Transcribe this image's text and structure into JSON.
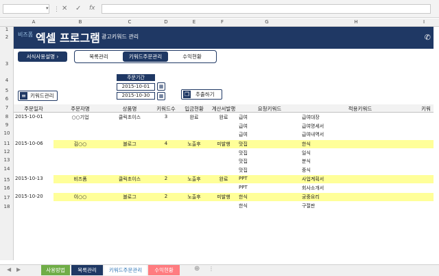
{
  "formula_bar": {
    "fx_label": "fx"
  },
  "columns": [
    "A",
    "B",
    "C",
    "D",
    "E",
    "F",
    "G",
    "H",
    "I"
  ],
  "rows": [
    "1",
    "2",
    "3",
    "4",
    "5",
    "6",
    "7",
    "8",
    "9",
    "10",
    "11",
    "12",
    "13",
    "14",
    "15",
    "16",
    "17",
    "18"
  ],
  "banner": {
    "brand_small": "비즈폼",
    "title": "엑셀 프로그램",
    "subtitle": "광고키워드 관리"
  },
  "buttons": {
    "guide": "서식사용설명",
    "keyword_mgmt": "키워드관리",
    "extract": "추출하기"
  },
  "tabs": [
    "목록관리",
    "키워드주문관리",
    "수익현황"
  ],
  "period": {
    "label": "주문기간",
    "start": "2015-10-01",
    "end": "2015-10-30"
  },
  "table": {
    "headers": [
      "주문일자",
      "주문자명",
      "상품명",
      "키워드수",
      "입금현황",
      "계산서발행",
      "요청키워드",
      "적용키워드",
      "키워"
    ],
    "groups": [
      {
        "date": "2015-10-01",
        "customer": "○○기업",
        "product": "클릭초이스",
        "count": "3",
        "payment": "완료",
        "invoice": "완료",
        "highlight": false,
        "requested": [
          "급여",
          "급여",
          "급여"
        ],
        "applied": [
          "급여대장",
          "급여명세서",
          "급여내역서"
        ]
      },
      {
        "date": "2015-10-06",
        "customer": "김○○",
        "product": "블로그",
        "count": "4",
        "payment": "노출후",
        "invoice": "미발행",
        "highlight": true,
        "requested": [
          "맛집",
          "맛집",
          "맛집",
          "맛집"
        ],
        "applied": [
          "한식",
          "일식",
          "분식",
          "중식"
        ]
      },
      {
        "date": "2015-10-13",
        "customer": "비즈폼",
        "product": "클릭초이스",
        "count": "2",
        "payment": "노출후",
        "invoice": "완료",
        "highlight": true,
        "requested": [
          "PPT",
          "PPT"
        ],
        "applied": [
          "사업계획서",
          "회사소개서"
        ]
      },
      {
        "date": "2015-10-20",
        "customer": "이○○",
        "product": "블로그",
        "count": "2",
        "payment": "노출후",
        "invoice": "미발행",
        "highlight": true,
        "requested": [
          "한식",
          "한식"
        ],
        "applied": [
          "궁중요리",
          "구절판"
        ]
      }
    ]
  },
  "sheet_tabs": [
    {
      "label": "사용방법",
      "color": "#70ad47",
      "text": "#ffffff"
    },
    {
      "label": "목록관리",
      "color": "#1f3864",
      "text": "#ffffff"
    },
    {
      "label": "키워드주문관리",
      "color": "#ffffff",
      "text": "#2e75b6"
    },
    {
      "label": "수익현황",
      "color": "#ff7c80",
      "text": "#ffffff"
    }
  ],
  "colors": {
    "navy": "#1f3864",
    "highlight": "#ffff99"
  }
}
